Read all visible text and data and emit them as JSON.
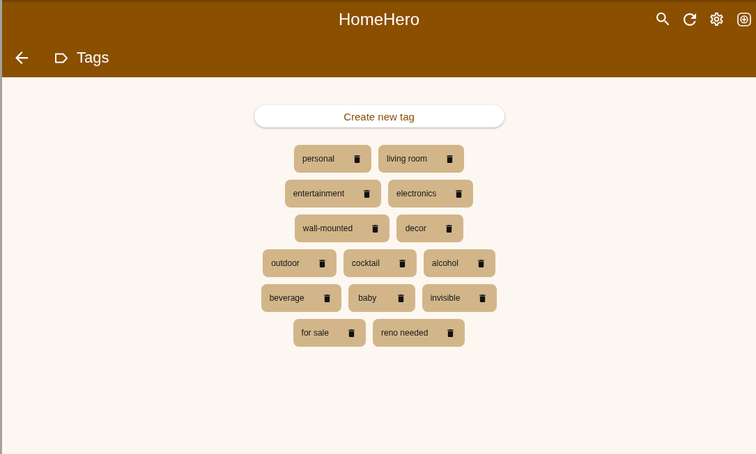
{
  "app_bar": {
    "title": "HomeHero"
  },
  "page_bar": {
    "title": "Tags"
  },
  "create_button": {
    "label": "Create new tag"
  },
  "tags": [
    {
      "label": "personal"
    },
    {
      "label": "living room"
    },
    {
      "label": "entertainment"
    },
    {
      "label": "electronics"
    },
    {
      "label": "wall-mounted"
    },
    {
      "label": "decor"
    },
    {
      "label": "outdoor"
    },
    {
      "label": "cocktail"
    },
    {
      "label": "alcohol"
    },
    {
      "label": "beverage"
    },
    {
      "label": "baby"
    },
    {
      "label": "invisible"
    },
    {
      "label": "for sale"
    },
    {
      "label": "reno needed"
    }
  ]
}
